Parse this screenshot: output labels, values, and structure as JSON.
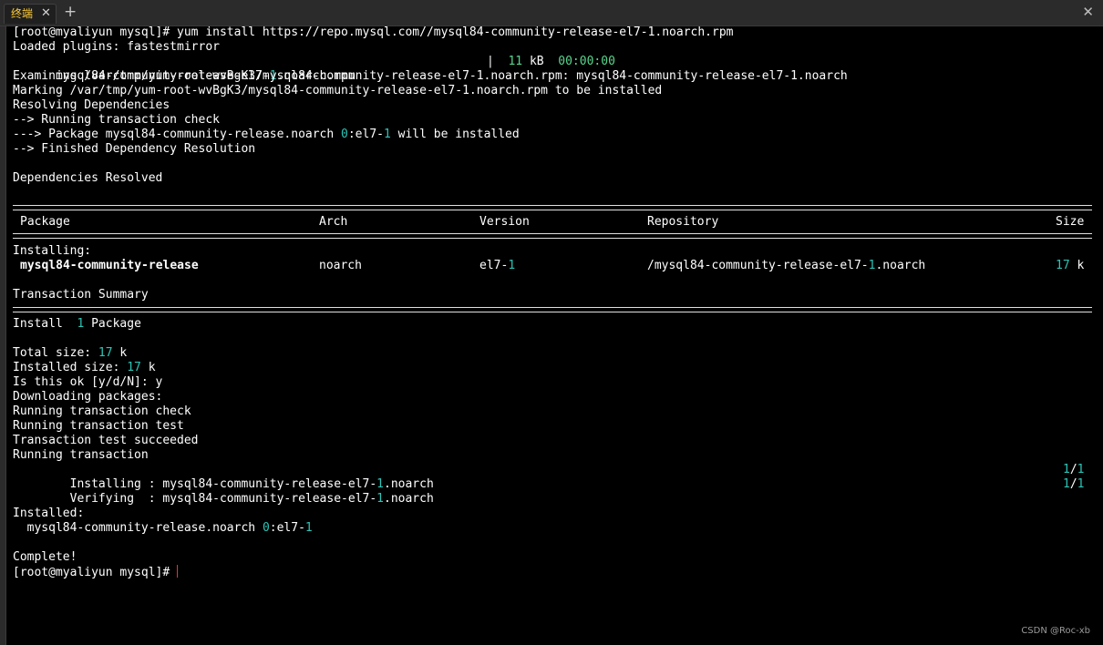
{
  "tabbar": {
    "tab_label": "终端",
    "tab_close": "✕",
    "new_tab": "+",
    "window_close": "✕"
  },
  "terminal": {
    "l1": "[root@myaliyun mysql]# yum install https://repo.mysql.com//mysql84-community-release-el7-1.noarch.rpm",
    "l2": "Loaded plugins: fastestmirror",
    "l3a": "mysql84-community-release-el7-",
    "l3b": "1",
    "l3c": ".noarch.rpm",
    "l3d": "|  ",
    "l3e": "11",
    "l3f": " kB  ",
    "l3g": "00:00:00",
    "l4": "Examining /var/tmp/yum-root-wvBgK3/mysql84-community-release-el7-1.noarch.rpm: mysql84-community-release-el7-1.noarch",
    "l5": "Marking /var/tmp/yum-root-wvBgK3/mysql84-community-release-el7-1.noarch.rpm to be installed",
    "l6": "Resolving Dependencies",
    "l7": "--> Running transaction check",
    "l8a": "---> Package mysql84-community-release.noarch ",
    "l8b": "0",
    "l8c": ":el7-",
    "l8d": "1",
    "l8e": " will be installed",
    "l9": "--> Finished Dependency Resolution",
    "l10": "Dependencies Resolved",
    "table": {
      "headers": [
        "Package",
        "Arch",
        "Version",
        "Repository",
        "Size"
      ],
      "installing_label": "Installing:",
      "row": {
        "package": "mysql84-community-release",
        "arch": "noarch",
        "version_a": "el7-",
        "version_b": "1",
        "repo_a": "/mysql84-community-release-el7-",
        "repo_b": "1",
        "repo_c": ".noarch",
        "size_a": "17",
        "size_b": " k"
      }
    },
    "summary_title": "Transaction Summary",
    "install_a": "Install  ",
    "install_b": "1",
    "install_c": " Package",
    "total_a": "Total size: ",
    "total_b": "17",
    "total_c": " k",
    "installed_size_a": "Installed size: ",
    "installed_size_b": "17",
    "installed_size_c": " k",
    "confirm": "Is this ok [y/d/N]: y",
    "downloading": "Downloading packages:",
    "rt_check": "Running transaction check",
    "rt_test": "Running transaction test",
    "rt_succeeded": "Transaction test succeeded",
    "rt": "Running transaction",
    "installing_a": "  Installing : mysql84-community-release-el7-",
    "installing_b": "1",
    "installing_c": ".noarch",
    "installing_prog_a": "1",
    "installing_prog_b": "/",
    "installing_prog_c": "1",
    "verifying_a": "  Verifying  : mysql84-community-release-el7-",
    "verifying_b": "1",
    "verifying_c": ".noarch",
    "verifying_prog_a": "1",
    "verifying_prog_b": "/",
    "verifying_prog_c": "1",
    "installed_title": "Installed:",
    "installed_a": "  mysql84-community-release.noarch ",
    "installed_b": "0",
    "installed_c": ":el7-",
    "installed_d": "1",
    "complete": "Complete!",
    "prompt": "[root@myaliyun mysql]#"
  },
  "watermark": "CSDN @Roc-xb",
  "colors": {
    "accent_number": "#2ec4b6",
    "tab_label": "#ffcc33",
    "cursor": "#ff2a2a"
  }
}
